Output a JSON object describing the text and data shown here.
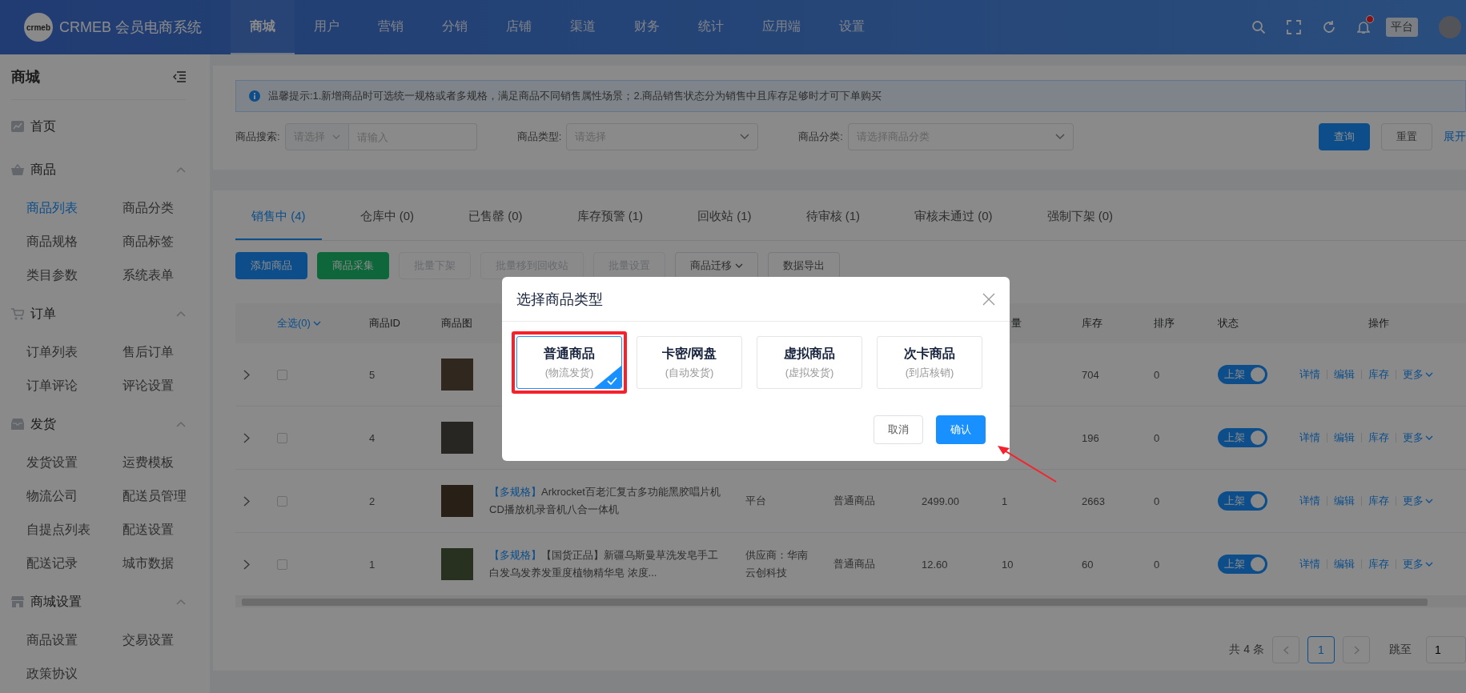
{
  "top_nav": {
    "logo_text": "CRMEB 会员电商系统",
    "logo_mark": "crmeb",
    "items": [
      {
        "label": "商城",
        "selected": true
      },
      {
        "label": "用户",
        "selected": false
      },
      {
        "label": "营销",
        "selected": false
      },
      {
        "label": "分销",
        "selected": false
      },
      {
        "label": "店铺",
        "selected": false
      },
      {
        "label": "渠道",
        "selected": false
      },
      {
        "label": "财务",
        "selected": false
      },
      {
        "label": "统计",
        "selected": false
      },
      {
        "label": "应用端",
        "selected": false
      },
      {
        "label": "设置",
        "selected": false
      }
    ],
    "platform_badge": "平台"
  },
  "sidebar": {
    "title": "商城",
    "sections": [
      {
        "label": "首页",
        "kind": "link"
      },
      {
        "label": "商品",
        "kind": "group",
        "expanded": true,
        "children": [
          {
            "label": "商品列表",
            "selected": true
          },
          {
            "label": "商品分类",
            "selected": false
          },
          {
            "label": "商品规格",
            "selected": false
          },
          {
            "label": "商品标签",
            "selected": false
          },
          {
            "label": "类目参数",
            "selected": false
          },
          {
            "label": "系统表单",
            "selected": false
          }
        ]
      },
      {
        "label": "订单",
        "kind": "group",
        "expanded": true,
        "children": [
          {
            "label": "订单列表",
            "selected": false
          },
          {
            "label": "售后订单",
            "selected": false
          },
          {
            "label": "订单评论",
            "selected": false
          },
          {
            "label": "评论设置",
            "selected": false
          }
        ]
      },
      {
        "label": "发货",
        "kind": "group",
        "expanded": true,
        "children": [
          {
            "label": "发货设置",
            "selected": false
          },
          {
            "label": "运费模板",
            "selected": false
          },
          {
            "label": "物流公司",
            "selected": false
          },
          {
            "label": "配送员管理",
            "selected": false
          },
          {
            "label": "自提点列表",
            "selected": false
          },
          {
            "label": "配送设置",
            "selected": false
          },
          {
            "label": "配送记录",
            "selected": false
          },
          {
            "label": "城市数据",
            "selected": false
          }
        ]
      },
      {
        "label": "商城设置",
        "kind": "group",
        "expanded": true,
        "children": [
          {
            "label": "商品设置",
            "selected": false
          },
          {
            "label": "交易设置",
            "selected": false
          },
          {
            "label": "政策协议",
            "selected": false
          }
        ]
      }
    ]
  },
  "notice": "温馨提示:1.新增商品时可选统一规格或者多规格，满足商品不同销售属性场景；2.商品销售状态分为销售中且库存足够时才可下单购买",
  "filters": [
    {
      "kind": "combo",
      "label": "商品搜索:",
      "select_placeholder": "请选择",
      "placeholder": "请输入"
    },
    {
      "kind": "select",
      "label": "商品类型:",
      "placeholder": "请选择"
    },
    {
      "kind": "select",
      "label": "商品分类:",
      "placeholder": "请选择商品分类"
    }
  ],
  "filter_buttons": {
    "query": "查询",
    "reset": "重置",
    "expand": "展开"
  },
  "tabs": [
    {
      "label": "销售中 (4)",
      "selected": true
    },
    {
      "label": "仓库中 (0)",
      "selected": false
    },
    {
      "label": "已售罄 (0)",
      "selected": false
    },
    {
      "label": "库存预警 (1)",
      "selected": false
    },
    {
      "label": "回收站 (1)",
      "selected": false
    },
    {
      "label": "待审核 (1)",
      "selected": false
    },
    {
      "label": "审核未通过 (0)",
      "selected": false
    },
    {
      "label": "强制下架 (0)",
      "selected": false
    }
  ],
  "toolbar": [
    {
      "label": "添加商品",
      "kind": "primary",
      "disabled": false
    },
    {
      "label": "商品采集",
      "kind": "success",
      "disabled": false
    },
    {
      "label": "批量下架",
      "kind": "default",
      "disabled": true
    },
    {
      "label": "批量移到回收站",
      "kind": "default",
      "disabled": true
    },
    {
      "label": "批量设置",
      "kind": "default",
      "disabled": true
    },
    {
      "label": "商品迁移",
      "kind": "dropdown",
      "disabled": false
    },
    {
      "label": "数据导出",
      "kind": "default",
      "disabled": false
    }
  ],
  "table": {
    "header": {
      "select_all": "全选(0)",
      "id": "商品ID",
      "image": "商品图",
      "sales": "量",
      "stock": "库存",
      "sort": "排序",
      "status": "状态",
      "actions": "操作"
    },
    "rows": [
      {
        "checked": false,
        "id": "5",
        "stock": "704",
        "sort": "0",
        "status": {
          "label": "上架",
          "on": true
        },
        "actions": [
          "详情",
          "编辑",
          "库存",
          "更多"
        ]
      },
      {
        "checked": false,
        "id": "4",
        "stock": "196",
        "sort": "0",
        "status": {
          "label": "上架",
          "on": true
        },
        "actions": [
          "详情",
          "编辑",
          "库存",
          "更多"
        ]
      },
      {
        "checked": false,
        "id": "2",
        "tag": "【多规格】",
        "name": "Arkrocket百老汇复古多功能黑胶唱片机CD播放机录音机八合一体机",
        "supplier": "平台",
        "type": "普通商品",
        "price": "2499.00",
        "sales": "1",
        "stock": "2663",
        "sort": "0",
        "status": {
          "label": "上架",
          "on": true
        },
        "actions": [
          "详情",
          "编辑",
          "库存",
          "更多"
        ]
      },
      {
        "checked": false,
        "id": "1",
        "tag": "【多规格】",
        "name": "【国货正品】新疆乌斯曼草洗发皂手工白发乌发养发重度植物精华皂 浓度...",
        "supplier": "供应商：华南云创科技",
        "type": "普通商品",
        "price": "12.60",
        "sales": "10",
        "stock": "60",
        "sort": "0",
        "status": {
          "label": "上架",
          "on": true
        },
        "actions": [
          "详情",
          "编辑",
          "库存",
          "更多"
        ]
      }
    ]
  },
  "pagination": {
    "total": "共 4 条",
    "pages": [
      {
        "label": "1",
        "selected": true
      }
    ],
    "jump_label": "跳至",
    "jump_value": "1"
  },
  "dialog": {
    "title": "选择商品类型",
    "options": [
      {
        "title": "普通商品",
        "subtitle": "(物流发货)",
        "selected": true
      },
      {
        "title": "卡密/网盘",
        "subtitle": "(自动发货)",
        "selected": false
      },
      {
        "title": "虚拟商品",
        "subtitle": "(虚拟发货)",
        "selected": false
      },
      {
        "title": "次卡商品",
        "subtitle": "(到店核销)",
        "selected": false
      }
    ],
    "cancel": "取消",
    "confirm": "确认"
  }
}
